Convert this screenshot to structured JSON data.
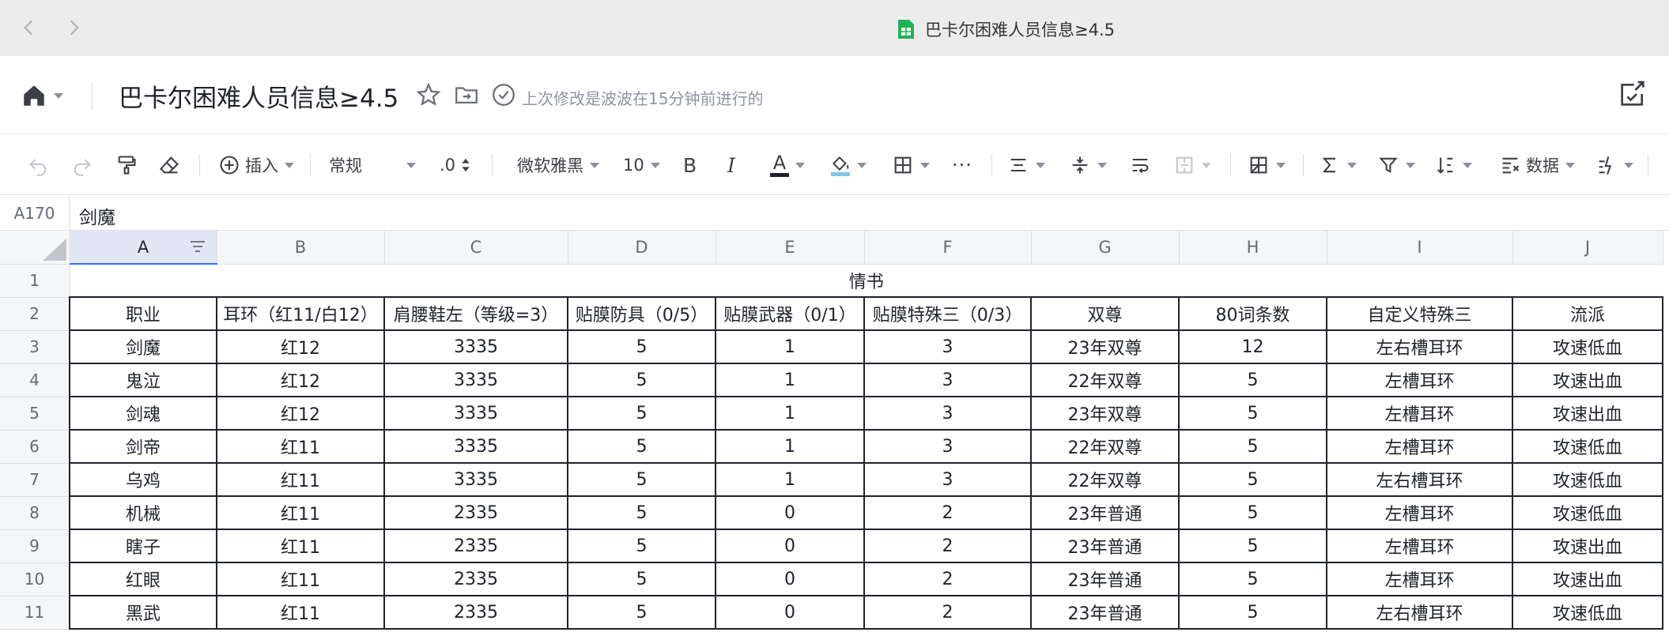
{
  "window": {
    "title": "巴卡尔困难人员信息≥4.5",
    "colors": {
      "bar_bg": "#ececec",
      "sheet_icon": "#1fb355"
    }
  },
  "header": {
    "doc_title": "巴卡尔困难人员信息≥4.5",
    "save_status": "上次修改是波波在15分钟前进行的",
    "icons": [
      "home-icon",
      "star-icon",
      "move-to-folder-icon",
      "saved-check-icon",
      "share-edit-icon"
    ]
  },
  "toolbar": {
    "insert_label": "插入",
    "format_label": "常规",
    "decimal_label": ".0",
    "font_label": "微软雅黑",
    "size_label": "10",
    "bold_label": "B",
    "italic_label": "I",
    "text_color_label": "A",
    "more_label": "···",
    "data_label": "数据",
    "colors": {
      "text_color": "#1f2329",
      "fill_color": "#7ec8e3"
    }
  },
  "formula_bar": {
    "cell_ref": "A170",
    "content": "剑魔"
  },
  "grid": {
    "columns": [
      "A",
      "B",
      "C",
      "D",
      "E",
      "F",
      "G",
      "H",
      "I",
      "J"
    ],
    "row_numbers": [
      "1",
      "2",
      "3",
      "4",
      "5",
      "6",
      "7",
      "8",
      "9",
      "10",
      "11"
    ],
    "merged_title": "情书",
    "headers": [
      "职业",
      "耳环（红11/白12）",
      "肩腰鞋左（等级=3）",
      "贴膜防具（0/5）",
      "贴膜武器（0/1）",
      "贴膜特殊三（0/3）",
      "双尊",
      "80词条数",
      "自定义特殊三",
      "流派"
    ],
    "rows": [
      [
        "剑魔",
        "红12",
        "3335",
        "5",
        "1",
        "3",
        "23年双尊",
        "12",
        "左右槽耳环",
        "攻速低血"
      ],
      [
        "鬼泣",
        "红12",
        "3335",
        "5",
        "1",
        "3",
        "22年双尊",
        "5",
        "左槽耳环",
        "攻速出血"
      ],
      [
        "剑魂",
        "红12",
        "3335",
        "5",
        "1",
        "3",
        "23年双尊",
        "5",
        "左槽耳环",
        "攻速出血"
      ],
      [
        "剑帝",
        "红11",
        "3335",
        "5",
        "1",
        "3",
        "22年双尊",
        "5",
        "左槽耳环",
        "攻速低血"
      ],
      [
        "乌鸡",
        "红11",
        "3335",
        "5",
        "1",
        "3",
        "22年双尊",
        "5",
        "左右槽耳环",
        "攻速低血"
      ],
      [
        "机械",
        "红11",
        "2335",
        "5",
        "0",
        "2",
        "23年普通",
        "5",
        "左槽耳环",
        "攻速低血"
      ],
      [
        "瞎子",
        "红11",
        "2335",
        "5",
        "0",
        "2",
        "23年普通",
        "5",
        "左槽耳环",
        "攻速出血"
      ],
      [
        "红眼",
        "红11",
        "2335",
        "5",
        "0",
        "2",
        "23年普通",
        "5",
        "左槽耳环",
        "攻速出血"
      ],
      [
        "黑武",
        "红11",
        "2335",
        "5",
        "0",
        "2",
        "23年普通",
        "5",
        "左右槽耳环",
        "攻速低血"
      ]
    ],
    "selected_column": "A"
  }
}
